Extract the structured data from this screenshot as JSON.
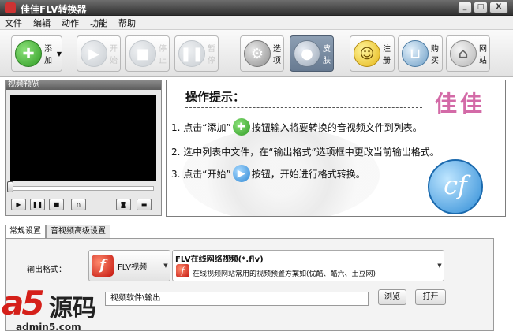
{
  "window": {
    "title": "佳佳FLV转换器",
    "controls": [
      "_",
      "□",
      "X"
    ]
  },
  "menu": [
    "文件",
    "编辑",
    "动作",
    "功能",
    "帮助"
  ],
  "toolbar": {
    "add": "添加",
    "start": "开始",
    "stop": "停止",
    "pause": "暂停",
    "options": "选项",
    "skin": "皮肤",
    "register": "注册",
    "buy": "购买",
    "website": "网站"
  },
  "preview": {
    "title": "视频预览",
    "seek_fraction": 0.0
  },
  "tips": {
    "heading": "操作提示：",
    "brand": "佳佳",
    "line1_a": "1. 点击“添加”",
    "line1_b": "按钮输入将要转换的音视频文件到列表。",
    "line2": "2. 选中列表中文件，在“输出格式”选项框中更改当前输出格式。",
    "line3_a": "3. 点击“开始”",
    "line3_b": "按钮，开始进行格式转换。",
    "logo": "cf"
  },
  "settings": {
    "tabs": [
      "常规设置",
      "音视频高级设置"
    ],
    "output_label": "输出格式：",
    "format": "FLV视频",
    "subformat_title": "FLV在线网络视频(*.flv)",
    "subformat_desc": "在线视频网站常用的视频预置方案如(优酷、酷六、土豆网)",
    "output_path": "视频软件\\输出",
    "browse": "浏览",
    "open": "打开"
  },
  "watermark": {
    "a5": "a5",
    "cn": "源码",
    "url": "admin5.com"
  },
  "colors": {
    "accent_green": "#2f9b23",
    "flash_red": "#c3140d",
    "brand_pink": "#d36aa7",
    "watermark_red": "#d5201a"
  }
}
